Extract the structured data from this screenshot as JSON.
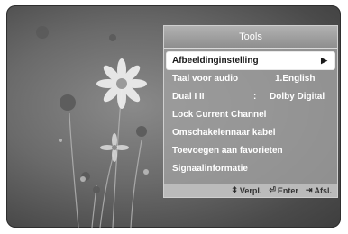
{
  "menu": {
    "title": "Tools",
    "items": [
      {
        "label": "Afbeeldinginstelling",
        "value": "",
        "arrow": "▶"
      },
      {
        "label": "Taal voor audio",
        "value": "1.English"
      },
      {
        "label": "Dual I II",
        "separator": ":",
        "value": "Dolby Digital"
      },
      {
        "label": "Lock Current Channel"
      },
      {
        "label": "Omschakelennaar kabel"
      },
      {
        "label": "Toevoegen aan favorieten"
      },
      {
        "label": "Signaalinformatie"
      }
    ],
    "footer": {
      "move_label": "Verpl.",
      "enter_label": "Enter",
      "exit_label": "Afsl."
    }
  },
  "icons": {
    "move": "updown-arrows-icon",
    "enter": "enter-icon",
    "exit": "exit-icon"
  }
}
